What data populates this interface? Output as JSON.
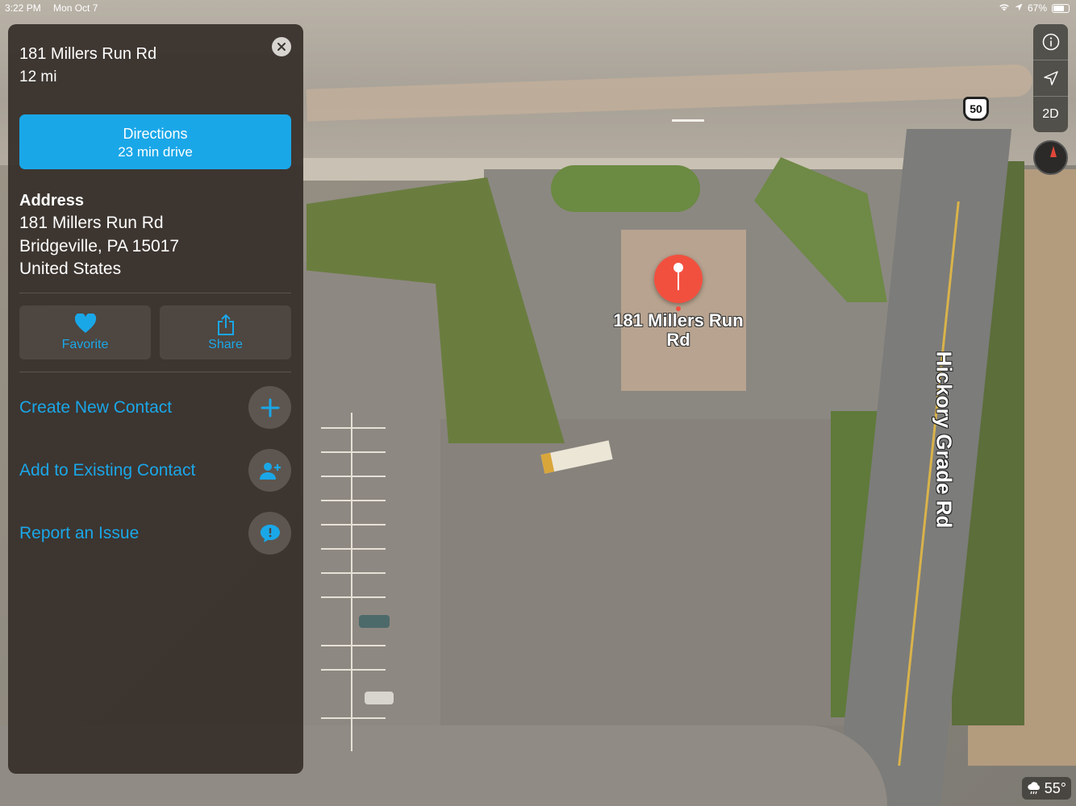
{
  "status_bar": {
    "time": "3:22 PM",
    "date": "Mon Oct 7",
    "battery": "67%"
  },
  "map": {
    "pin_label": "181 Millers Run Rd",
    "street_label": "Hickory Grade Rd",
    "route_shield": "50",
    "mode_toggle": "2D",
    "weather_temp": "55°"
  },
  "card": {
    "title": "181 Millers Run Rd",
    "distance": "12 mi",
    "directions": {
      "label": "Directions",
      "subtitle": "23 min drive"
    },
    "address": {
      "heading": "Address",
      "lines": [
        "181 Millers Run Rd",
        "Bridgeville, PA  15017",
        "United States"
      ]
    },
    "actions": [
      {
        "label": "Favorite",
        "icon": "heart-icon"
      },
      {
        "label": "Share",
        "icon": "share-icon"
      }
    ],
    "rows": [
      {
        "label": "Create New Contact",
        "icon": "plus-icon"
      },
      {
        "label": "Add to Existing Contact",
        "icon": "add-person-icon"
      },
      {
        "label": "Report an Issue",
        "icon": "report-bubble-icon"
      }
    ]
  },
  "colors": {
    "accent": "#1aa7e8",
    "pin": "#f2503f",
    "card_bg": "#37302a"
  }
}
